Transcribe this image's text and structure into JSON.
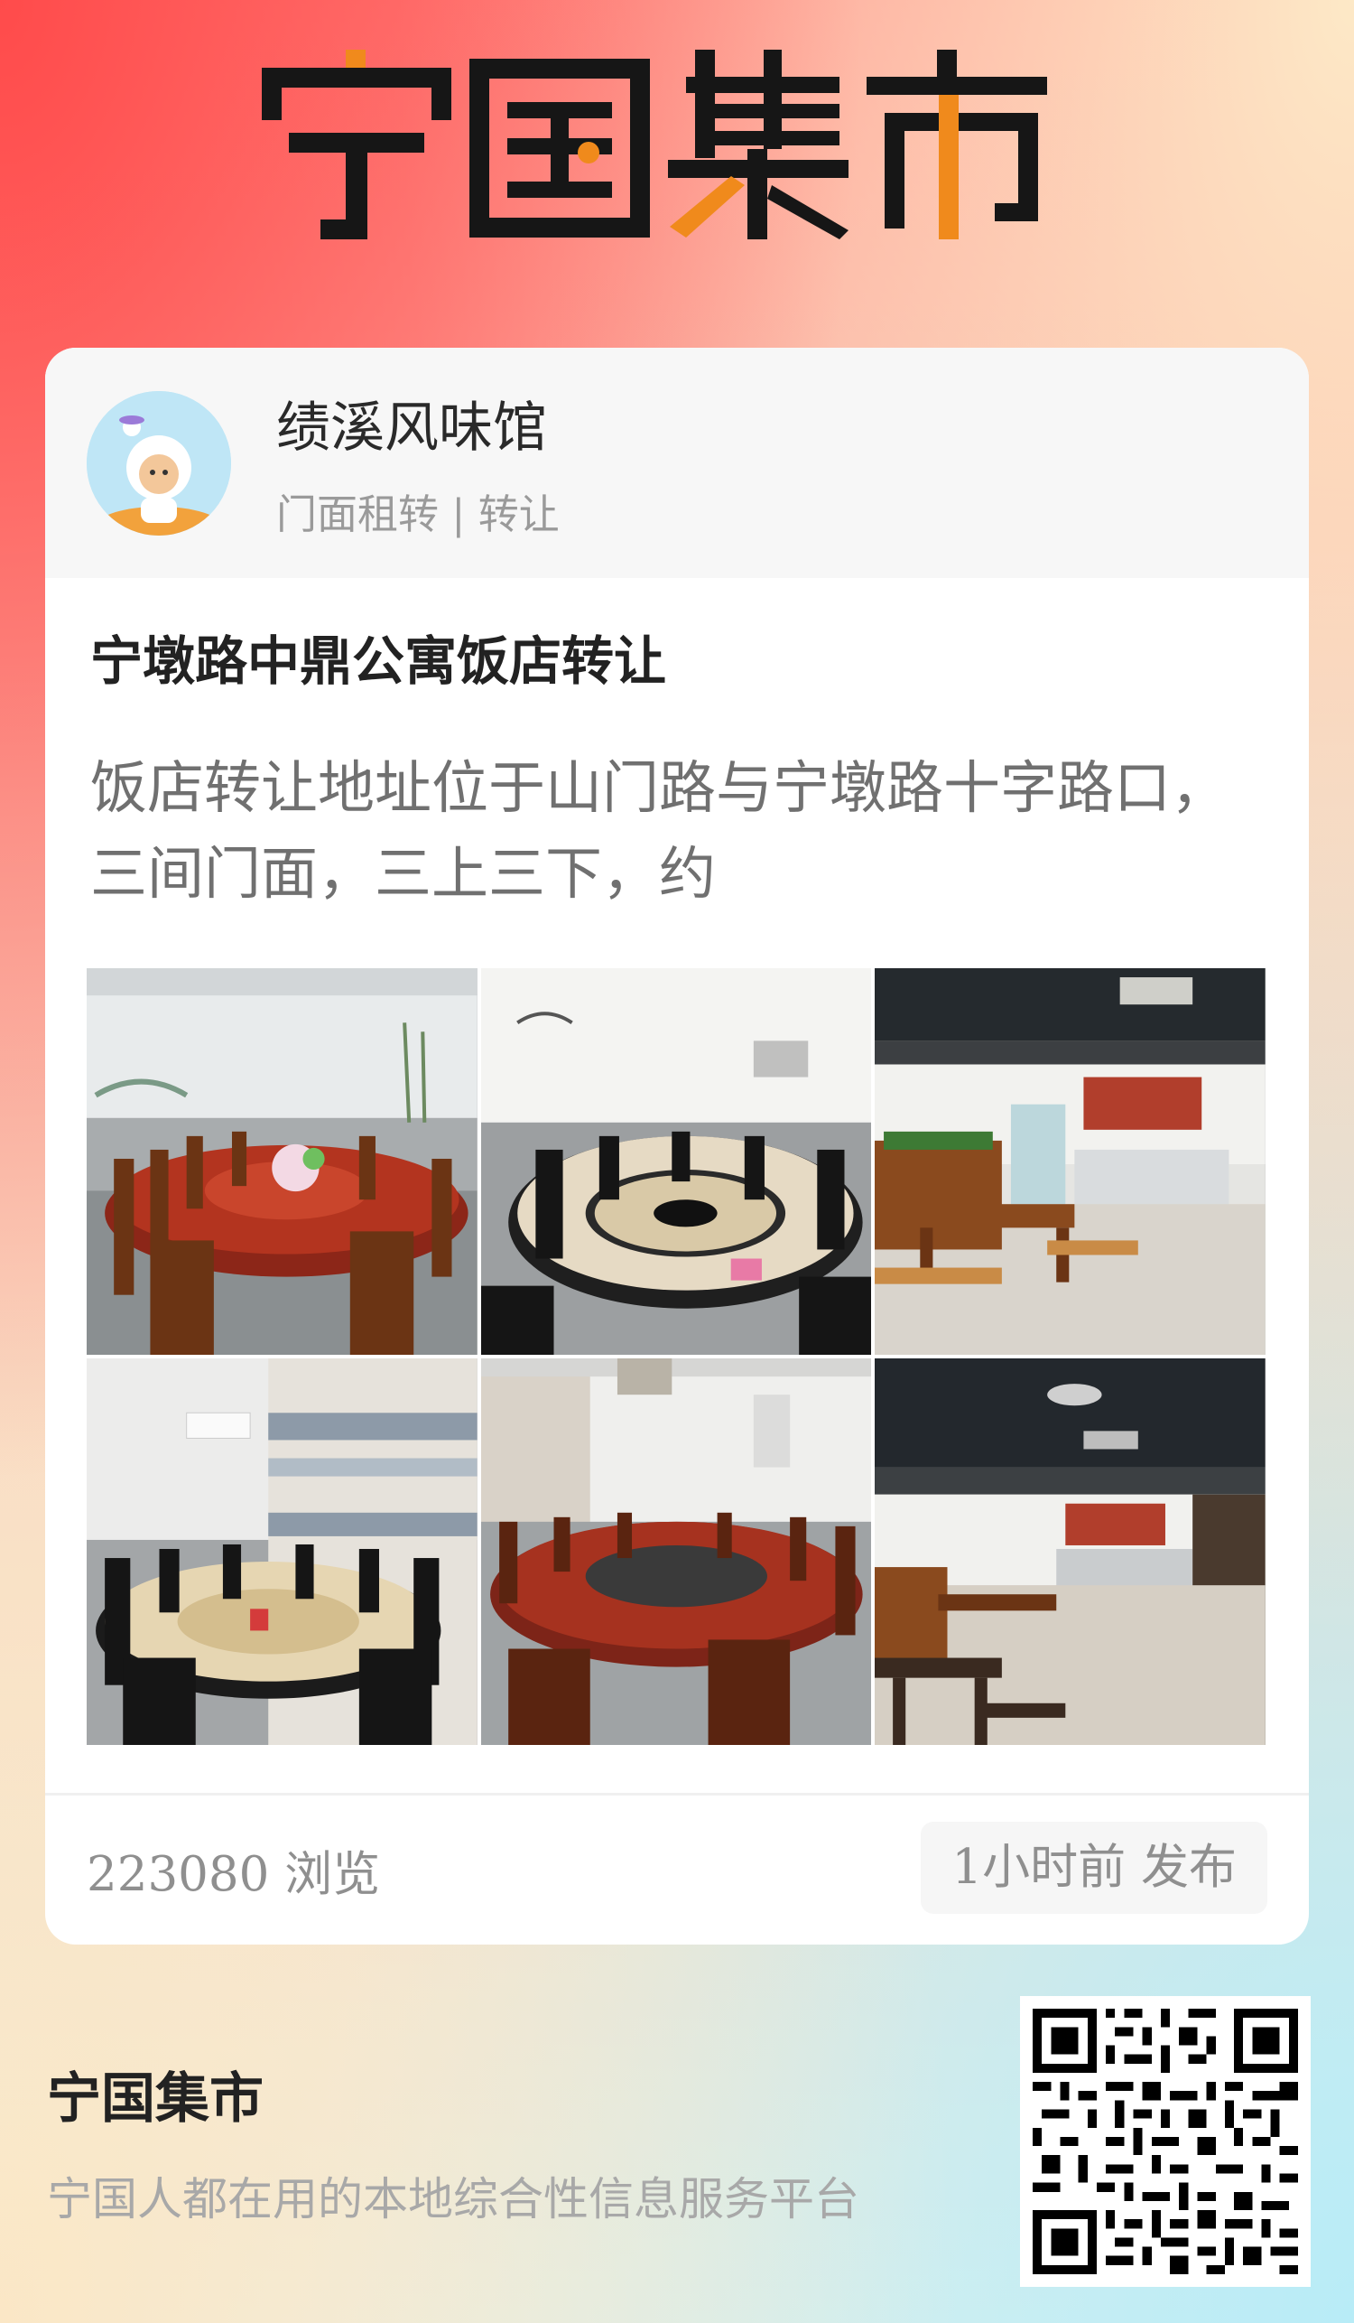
{
  "app": {
    "logo_text": "宁国集市",
    "brand_colors": {
      "accent": "#f08a1c",
      "dark": "#161616"
    }
  },
  "post": {
    "author_name": "绩溪风味馆",
    "category": "门面租转 | 转让",
    "title": "宁墩路中鼎公寓饭店转让",
    "excerpt": "饭店转让地址位于山门路与宁墩路十字路口，三间门面，三上三下，约",
    "photos": [
      {
        "icon": "restaurant-photo"
      },
      {
        "icon": "restaurant-photo"
      },
      {
        "icon": "restaurant-photo"
      },
      {
        "icon": "restaurant-photo"
      },
      {
        "icon": "restaurant-photo"
      },
      {
        "icon": "restaurant-photo"
      }
    ],
    "views": "223080 浏览",
    "published": "1小时前 发布"
  },
  "footer": {
    "title": "宁国集市",
    "tagline": "宁国人都在用的本地综合性信息服务平台",
    "qr_icon": "qr-code-icon"
  }
}
